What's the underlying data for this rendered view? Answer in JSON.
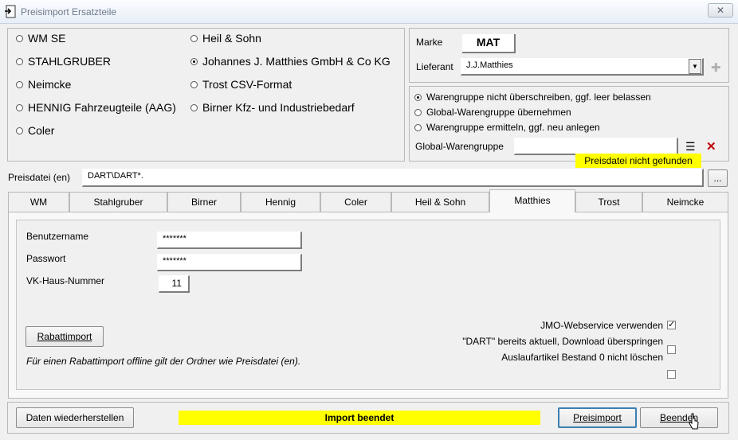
{
  "window": {
    "title": "Preisimport Ersatzteile",
    "close_glyph": "✕"
  },
  "suppliers": {
    "col1": [
      {
        "label": "WM SE",
        "selected": false
      },
      {
        "label": "STAHLGRUBER",
        "selected": false
      },
      {
        "label": "Neimcke",
        "selected": false
      },
      {
        "label": "HENNIG Fahrzeugteile (AAG)",
        "selected": false
      },
      {
        "label": "Coler",
        "selected": false
      }
    ],
    "col2": [
      {
        "label": "Heil & Sohn",
        "selected": false
      },
      {
        "label": "Johannes J. Matthies GmbH & Co KG",
        "selected": true
      },
      {
        "label": "Trost CSV-Format",
        "selected": false
      },
      {
        "label": "Birner Kfz- und Industriebedarf",
        "selected": false
      }
    ]
  },
  "brand": {
    "marke_label": "Marke",
    "marke_value": "MAT",
    "lieferant_label": "Lieferant",
    "lieferant_value": "J.J.Matthies",
    "dropdown_glyph": "▼",
    "add_glyph": "✚"
  },
  "warengruppe": {
    "options": [
      {
        "label": "Warengruppe nicht überschreiben, ggf. leer belassen",
        "selected": true
      },
      {
        "label": "Global-Warengruppe übernehmen",
        "selected": false
      },
      {
        "label": "Warengruppe ermitteln, ggf. neu anlegen",
        "selected": false
      }
    ],
    "global_label": "Global-Warengruppe",
    "global_value": "",
    "list_glyph": "☰",
    "delete_glyph": "✕",
    "status_notice": "Preisdatei nicht gefunden"
  },
  "preisdatei": {
    "label": "Preisdatei (en)",
    "value": "DART\\DART*.",
    "browse_label": "..."
  },
  "tabs": [
    "WM",
    "Stahlgruber",
    "Birner",
    "Hennig",
    "Coler",
    "Heil & Sohn",
    "Matthies",
    "Trost",
    "Neimcke"
  ],
  "active_tab": "Matthies",
  "matthies": {
    "benutzername_label": "Benutzername",
    "benutzername_value": "*******",
    "passwort_label": "Passwort",
    "passwort_value": "*******",
    "vk_label": "VK-Haus-Nummer",
    "vk_value": "11",
    "rabatt_button": "Rabattimport",
    "rabatt_hint": "Für einen Rabattimport offline gilt der Ordner wie Preisdatei (en).",
    "options": [
      {
        "label": "JMO-Webservice verwenden",
        "checked": true
      },
      {
        "label": "\"DART\" bereits aktuell, Download überspringen",
        "checked": false
      },
      {
        "label": "Auslaufartikel Bestand 0 nicht löschen",
        "checked": false
      }
    ],
    "check_glyph": "✓"
  },
  "footer": {
    "restore_button": "Daten wiederherstellen",
    "status": "Import beendet",
    "import_button": "Preisimport",
    "quit_button": "Beenden"
  }
}
